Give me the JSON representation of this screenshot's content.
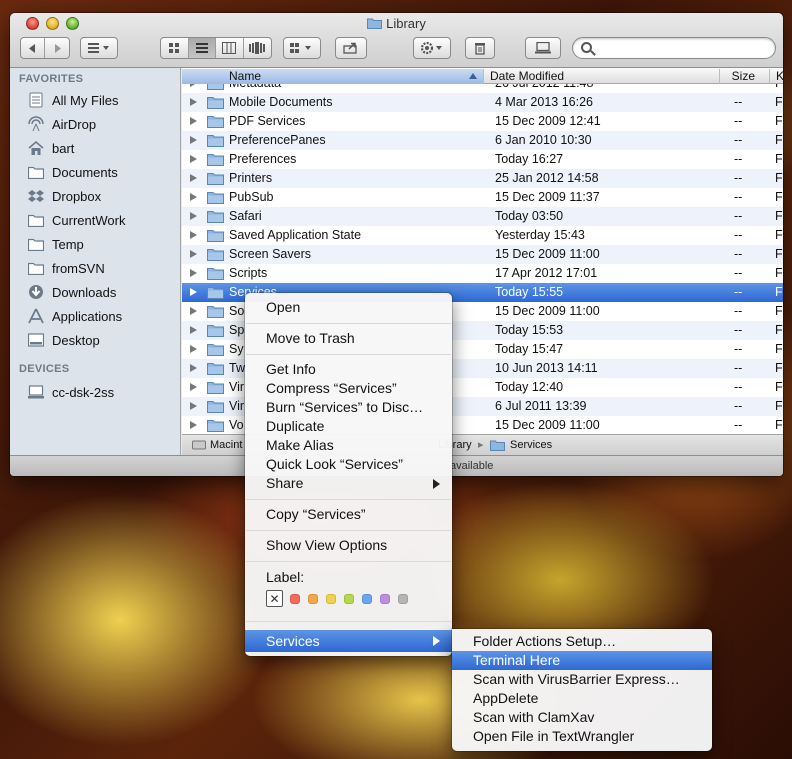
{
  "window": {
    "title": "Library"
  },
  "search": {
    "placeholder": ""
  },
  "sidebar": {
    "favorites_header": "FAVORITES",
    "favorites": [
      {
        "label": "All My Files",
        "icon": "all-files-icon"
      },
      {
        "label": "AirDrop",
        "icon": "airdrop-icon"
      },
      {
        "label": "bart",
        "icon": "home-icon"
      },
      {
        "label": "Documents",
        "icon": "folder-icon"
      },
      {
        "label": "Dropbox",
        "icon": "dropbox-icon"
      },
      {
        "label": "CurrentWork",
        "icon": "folder-icon"
      },
      {
        "label": "Temp",
        "icon": "folder-icon"
      },
      {
        "label": "fromSVN",
        "icon": "folder-icon"
      },
      {
        "label": "Downloads",
        "icon": "downloads-icon"
      },
      {
        "label": "Applications",
        "icon": "applications-icon"
      },
      {
        "label": "Desktop",
        "icon": "desktop-icon"
      }
    ],
    "devices_header": "DEVICES",
    "devices": [
      {
        "label": "cc-dsk-2ss",
        "icon": "computer-icon"
      }
    ]
  },
  "columns": {
    "name": "Name",
    "date": "Date Modified",
    "size": "Size",
    "kind": "Ki"
  },
  "rows": [
    {
      "name": "Metadata",
      "date": "26 Jul 2012 11:48",
      "size": "--",
      "kind": "Fo"
    },
    {
      "name": "Mobile Documents",
      "date": "4 Mar 2013 16:26",
      "size": "--",
      "kind": "Fo"
    },
    {
      "name": "PDF Services",
      "date": "15 Dec 2009 12:41",
      "size": "--",
      "kind": "Fo"
    },
    {
      "name": "PreferencePanes",
      "date": "6 Jan 2010 10:30",
      "size": "--",
      "kind": "Fo"
    },
    {
      "name": "Preferences",
      "date": "Today 16:27",
      "size": "--",
      "kind": "Fo"
    },
    {
      "name": "Printers",
      "date": "25 Jan 2012 14:58",
      "size": "--",
      "kind": "Fo"
    },
    {
      "name": "PubSub",
      "date": "15 Dec 2009 11:37",
      "size": "--",
      "kind": "Fo"
    },
    {
      "name": "Safari",
      "date": "Today 03:50",
      "size": "--",
      "kind": "Fo"
    },
    {
      "name": "Saved Application State",
      "date": "Yesterday 15:43",
      "size": "--",
      "kind": "Fo"
    },
    {
      "name": "Screen Savers",
      "date": "15 Dec 2009 11:00",
      "size": "--",
      "kind": "Fo"
    },
    {
      "name": "Scripts",
      "date": "17 Apr 2012 17:01",
      "size": "--",
      "kind": "Fo"
    },
    {
      "name": "Services",
      "date": "Today 15:55",
      "size": "--",
      "kind": "Fo",
      "selected": true
    },
    {
      "name": "So",
      "date": "15 Dec 2009 11:00",
      "size": "--",
      "kind": "Fo"
    },
    {
      "name": "Sp",
      "date": "Today 15:53",
      "size": "--",
      "kind": "Fo"
    },
    {
      "name": "Sy",
      "date": "Today 15:47",
      "size": "--",
      "kind": "Fo"
    },
    {
      "name": "Tw",
      "date": "10 Jun 2013 14:11",
      "size": "--",
      "kind": "Fo"
    },
    {
      "name": "Vir",
      "date": "Today 12:40",
      "size": "--",
      "kind": "Fo"
    },
    {
      "name": "Vir",
      "date": "6 Jul 2011 13:39",
      "size": "--",
      "kind": "Fo"
    },
    {
      "name": "Vo",
      "date": "15 Dec 2009 11:00",
      "size": "--",
      "kind": "Fo"
    }
  ],
  "pathbar": {
    "root": "Macint",
    "library": "Library",
    "current": "Services"
  },
  "statusbar": {
    "text": "available"
  },
  "context_menu": {
    "open": "Open",
    "trash": "Move to Trash",
    "get_info": "Get Info",
    "compress": "Compress “Services”",
    "burn": "Burn “Services” to Disc…",
    "duplicate": "Duplicate",
    "alias": "Make Alias",
    "quicklook": "Quick Look “Services”",
    "share": "Share",
    "copy": "Copy “Services”",
    "view_options": "Show View Options",
    "label": "Label:",
    "label_none": "✕",
    "label_colors": [
      "#f26b5b",
      "#f3a64a",
      "#f2d24b",
      "#b6d84a",
      "#6aa6f2",
      "#bd8ee0",
      "#b5b5b5"
    ],
    "services": "Services"
  },
  "services_submenu": [
    {
      "label": "Folder Actions Setup…"
    },
    {
      "label": "Terminal Here",
      "highlighted": true
    },
    {
      "label": "Scan with VirusBarrier Express…"
    },
    {
      "label": "AppDelete"
    },
    {
      "label": "Scan with ClamXav"
    },
    {
      "label": "Open File in TextWrangler"
    }
  ],
  "colors": {
    "selection": "#2d68d5",
    "folder": "#8fb6de"
  }
}
